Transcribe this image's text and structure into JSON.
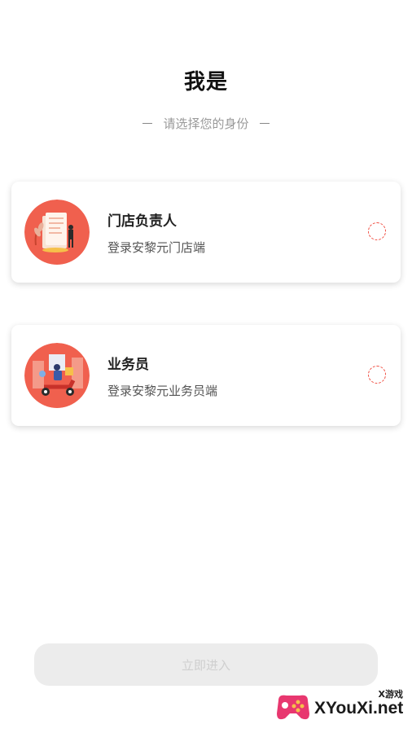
{
  "header": {
    "title": "我是",
    "subtitle": "请选择您的身份"
  },
  "roles": [
    {
      "title": "门店负责人",
      "description": "登录安黎元门店端",
      "icon": "store-manager-illustration",
      "selected": false
    },
    {
      "title": "业务员",
      "description": "登录安黎元业务员端",
      "icon": "salesman-scooter-illustration",
      "selected": false
    }
  ],
  "footer": {
    "enter_label": "立即进入"
  },
  "watermark": {
    "small": "X游戏",
    "big": "XYouXi.net"
  },
  "colors": {
    "accent": "#f04a3e",
    "avatar_bg": "#f0604e",
    "button_bg": "#ececec",
    "button_text": "#cfcfcf"
  }
}
